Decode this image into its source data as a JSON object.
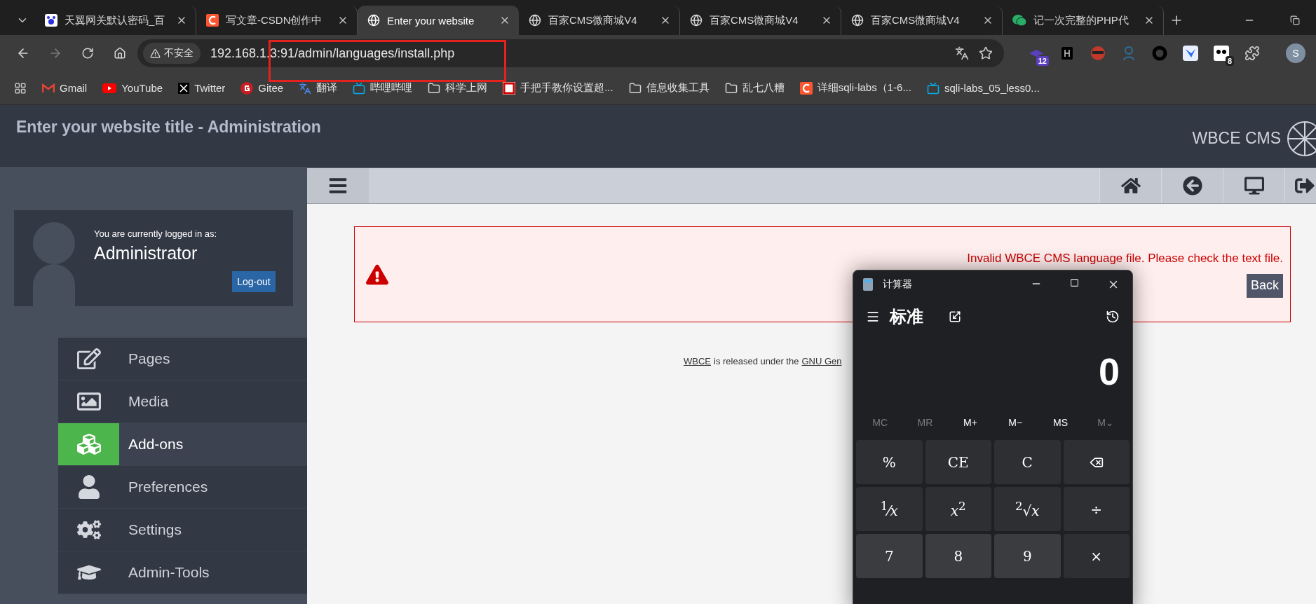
{
  "browser": {
    "tabs": [
      {
        "title": "天翼网关默认密码_百",
        "selected": false
      },
      {
        "title": "写文章-CSDN创作中",
        "selected": false
      },
      {
        "title": "Enter your website",
        "selected": true
      },
      {
        "title": "百家CMS微商城V4",
        "selected": false
      },
      {
        "title": "百家CMS微商城V4",
        "selected": false
      },
      {
        "title": "百家CMS微商城V4",
        "selected": false
      },
      {
        "title": "记一次完整的PHP代",
        "selected": false
      }
    ],
    "address": {
      "security": "不安全",
      "url": "192.168.1.3:91/admin/languages/install.php"
    },
    "extension_badges": [
      "12",
      "8"
    ],
    "profile": "S",
    "bookmarks": [
      "Gmail",
      "YouTube",
      "Twitter",
      "Gitee",
      "翻译",
      "哔哩哔哩",
      "科学上网",
      "手把手教你设置超...",
      "信息收集工具",
      "乱七八糟",
      "详细sqli-labs（1-6...",
      "sqli-labs_05_less0..."
    ]
  },
  "admin": {
    "title": "Enter your website title - Administration",
    "brand": "WBCE CMS",
    "user": {
      "caption": "You are currently logged in as:",
      "name": "Administrator",
      "logout": "Log-out"
    },
    "nav": [
      {
        "label": "Pages",
        "selected": false
      },
      {
        "label": "Media",
        "selected": false
      },
      {
        "label": "Add-ons",
        "selected": true
      },
      {
        "label": "Preferences",
        "selected": false
      },
      {
        "label": "Settings",
        "selected": false
      },
      {
        "label": "Admin-Tools",
        "selected": false
      }
    ],
    "alert": {
      "message": "Invalid WBCE CMS language file. Please check the text file.",
      "button": "Back"
    },
    "footer": {
      "link": "WBCE",
      "text": "is released under the",
      "link_2": "GNU Gen"
    }
  },
  "calculator": {
    "title": "计算器",
    "mode": "标准",
    "display": "0",
    "memory": [
      {
        "label": "MC",
        "disabled": true
      },
      {
        "label": "MR",
        "disabled": true
      },
      {
        "label": "M+",
        "disabled": false
      },
      {
        "label": "M−",
        "disabled": false
      },
      {
        "label": "MS",
        "disabled": false
      },
      {
        "label": "M⌄",
        "disabled": true
      }
    ],
    "keys": [
      {
        "kind": "operator",
        "label": "%"
      },
      {
        "kind": "operator",
        "label": "CE"
      },
      {
        "kind": "operator",
        "label": "C"
      },
      {
        "kind": "backspace"
      },
      {
        "kind": "operator",
        "label": "$^{1}$⁄*x*"
      },
      {
        "kind": "operator",
        "label": "*x*$^{2}$"
      },
      {
        "kind": "operator",
        "label": "$^{2}$√*x*"
      },
      {
        "kind": "operator",
        "label": "÷"
      },
      {
        "kind": "digit",
        "label": "7"
      },
      {
        "kind": "digit",
        "label": "8"
      },
      {
        "kind": "digit",
        "label": "9"
      },
      {
        "kind": "operator",
        "label": "×"
      }
    ]
  }
}
